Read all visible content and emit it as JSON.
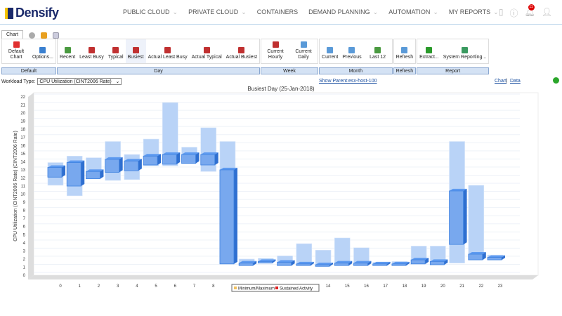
{
  "header": {
    "logo": "Densify",
    "nav": [
      {
        "label": "PUBLIC CLOUD",
        "dropdown": true
      },
      {
        "label": "PRIVATE CLOUD",
        "dropdown": true
      },
      {
        "label": "CONTAINERS",
        "dropdown": false
      },
      {
        "label": "DEMAND PLANNING",
        "dropdown": true
      },
      {
        "label": "AUTOMATION",
        "dropdown": true
      },
      {
        "label": "MY REPORTS",
        "dropdown": true
      }
    ],
    "notification_count": "11"
  },
  "tabs": {
    "active": "Chart"
  },
  "ribbon": [
    {
      "group": "Default",
      "buttons": [
        {
          "label": "Default Chart",
          "icon": "chart-icon"
        },
        {
          "label": "Options...",
          "icon": "options-icon"
        }
      ]
    },
    {
      "group": "Day",
      "buttons": [
        {
          "label": "Recent"
        },
        {
          "label": "Least Busy"
        },
        {
          "label": "Typical"
        },
        {
          "label": "Busiest",
          "selected": true
        },
        {
          "label": "Actual Least Busy"
        },
        {
          "label": "Actual Typical"
        },
        {
          "label": "Actual Busiest"
        }
      ]
    },
    {
      "group": "Week",
      "buttons": [
        {
          "label": "Current Hourly"
        },
        {
          "label": "Current Daily"
        }
      ]
    },
    {
      "group": "Month",
      "buttons": [
        {
          "label": "Current"
        },
        {
          "label": "Previous"
        },
        {
          "label": "Last 12"
        }
      ]
    },
    {
      "group": "Refresh",
      "buttons": [
        {
          "label": "Refresh"
        }
      ]
    },
    {
      "group": "Report",
      "buttons": [
        {
          "label": "Extract..."
        },
        {
          "label": "System Reporting..."
        }
      ]
    }
  ],
  "workload": {
    "label": "Workload Type:",
    "value": "CPU Utilization (CINT2006 Rate)"
  },
  "links": {
    "parent": "Show Parent:esx-host-100",
    "chart": "Chart",
    "sep": "|",
    "data": "Data"
  },
  "colors": {
    "range": "#b9d3f7",
    "sustained": "#3f82e0",
    "accent": "#1a4fa0"
  },
  "chart_data": {
    "type": "bar",
    "title": "Busiest Day (25-Jan-2018)",
    "ylabel": "CPU Utilization (CINT2006 Rate) (CINT2006 Rate)",
    "xlabel": "",
    "ylim": [
      0,
      22
    ],
    "grid": true,
    "legend_placement": "bottom",
    "categories": [
      "0",
      "1",
      "2",
      "3",
      "4",
      "5",
      "6",
      "7",
      "8",
      "9",
      "10",
      "11",
      "12",
      "13",
      "14",
      "15",
      "16",
      "17",
      "18",
      "19",
      "20",
      "21",
      "22",
      "23"
    ],
    "series": [
      {
        "name": "Minimum/Maximum",
        "low": [
          11.1,
          9.8,
          12,
          11.7,
          11.8,
          13.5,
          13.5,
          13.8,
          12.8,
          1.5,
          1.3,
          1.5,
          1.2,
          1.2,
          1.1,
          1.2,
          1.2,
          1.2,
          1.2,
          1.4,
          1.3,
          1.5,
          1.9,
          1.9
        ],
        "high": [
          13.9,
          14.7,
          14.5,
          16.5,
          14.9,
          16.8,
          21.3,
          15.8,
          18.2,
          16.5,
          2.0,
          2.1,
          2.4,
          3.9,
          3.1,
          4.6,
          3.4,
          1.6,
          1.7,
          3.6,
          3.6,
          16.5,
          11.1,
          2.5
        ]
      },
      {
        "name": "Sustained Activity",
        "low": [
          12.1,
          11,
          11.9,
          12.7,
          12.9,
          13.6,
          13.7,
          13.8,
          13.6,
          1.4,
          1.2,
          1.5,
          1.2,
          1.2,
          1.1,
          1.2,
          1.2,
          1.2,
          1.2,
          1.4,
          1.3,
          3.8,
          1.9,
          1.9
        ],
        "high": [
          13.3,
          13.9,
          12.8,
          14.3,
          14.1,
          14.7,
          14.9,
          14.9,
          14.9,
          13,
          1.5,
          1.7,
          1.6,
          1.4,
          1.3,
          1.5,
          1.5,
          1.4,
          1.4,
          1.9,
          1.7,
          10.4,
          2.6,
          2.2
        ]
      }
    ],
    "legend_colors": [
      "#f0c060",
      "#e02020"
    ]
  }
}
